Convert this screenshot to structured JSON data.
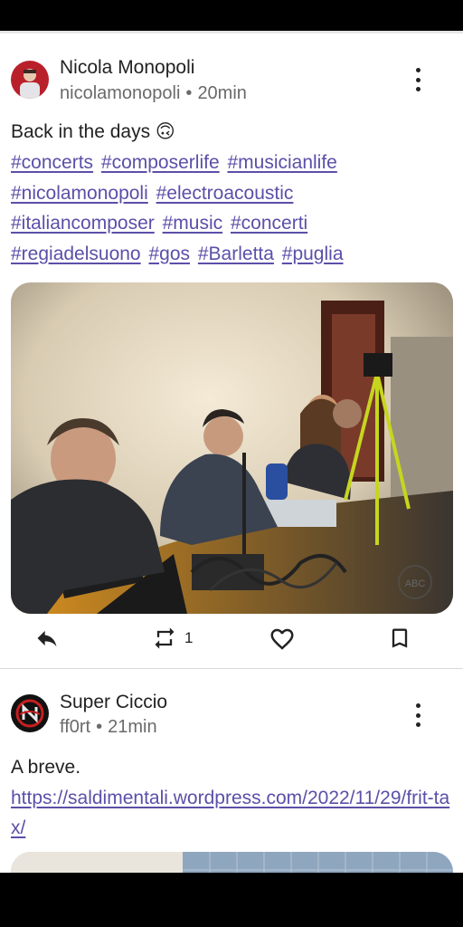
{
  "posts": [
    {
      "display_name": "Nicola Monopoli",
      "handle": "nicolamonopoli",
      "time": "20min",
      "text": "Back in the days 🙃",
      "hashtags": [
        [
          "#concerts",
          "#composerlife",
          "#musicianlife"
        ],
        [
          "#nicolamonopoli",
          "#electroacoustic"
        ],
        [
          "#italiancomposer",
          "#music",
          "#concerti"
        ],
        [
          "#regiadelsuono",
          "#gos",
          "#Barletta",
          "#puglia"
        ]
      ],
      "image_watermark": "ABC",
      "boost_count": "1"
    },
    {
      "display_name": "Super Ciccio",
      "handle": "ff0rt",
      "time": "21min",
      "text": "A breve.",
      "link": "https://saldimentali.wordpress.com/2022/11/29/frit-tax/"
    }
  ],
  "icons": {
    "reply": "reply-icon",
    "boost": "repeat-icon",
    "favourite": "heart-icon",
    "bookmark": "bookmark-icon",
    "more": "more-vertical-icon"
  },
  "colors": {
    "link": "#5b4fa8",
    "text": "#222222",
    "meta": "#6a6a6a"
  }
}
